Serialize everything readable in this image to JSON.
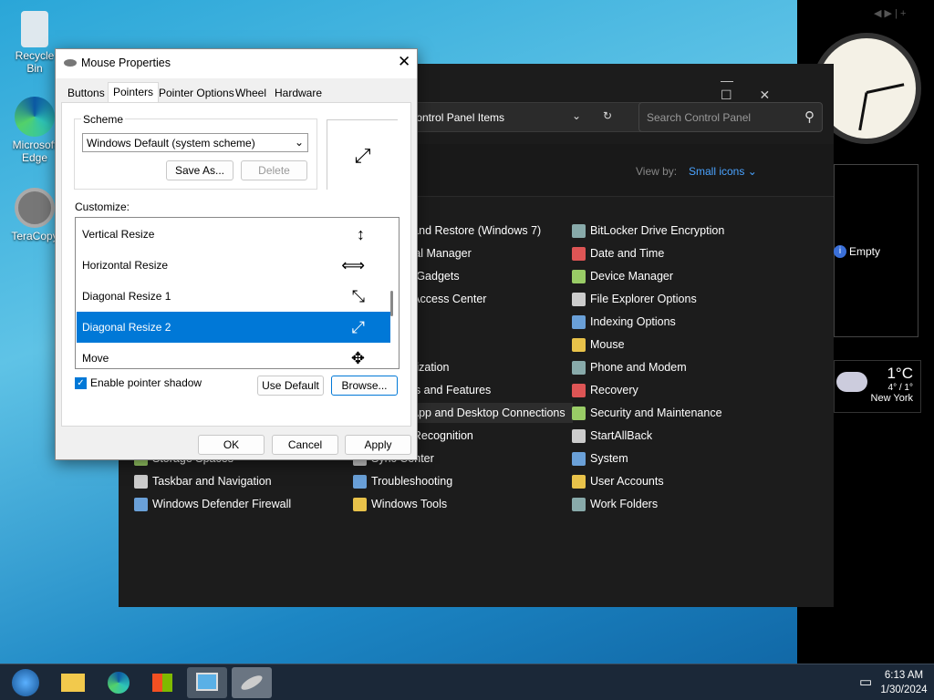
{
  "desktop": {
    "icons": [
      {
        "label": "Recycle Bin"
      },
      {
        "label": "Microsoft Edge"
      },
      {
        "label": "TeraCopy"
      }
    ]
  },
  "gadgets": {
    "slideshow_status": "Empty",
    "weather": {
      "temp": "1°C",
      "range": "4° / 1°",
      "city": "New York"
    },
    "clock": {
      "time": "6:13"
    }
  },
  "control_panel": {
    "address": "All Control Panel Items",
    "search_placeholder": "Search Control Panel",
    "view_by_label": "View by:",
    "view_by_value": "Small icons",
    "col1": [
      "",
      "",
      "",
      "",
      "",
      "",
      "",
      "",
      "",
      "",
      "Storage Spaces",
      "Taskbar and Navigation",
      "Windows Defender Firewall"
    ],
    "col2": [
      "Backup and Restore (Windows 7)",
      "Credential Manager",
      "Desktop Gadgets",
      "Ease of Access Center",
      "",
      "",
      "Personalization",
      "Programs and Features",
      "RemoteApp and Desktop Connections",
      "Speech Recognition",
      "Sync Center",
      "Troubleshooting",
      "Windows Tools"
    ],
    "col3": [
      "BitLocker Drive Encryption",
      "Date and Time",
      "Device Manager",
      "File Explorer Options",
      "Indexing Options",
      "Mouse",
      "Phone and Modem",
      "Recovery",
      "Security and Maintenance",
      "StartAllBack",
      "System",
      "User Accounts",
      "Work Folders"
    ],
    "hovered": "RemoteApp and Desktop Connections"
  },
  "dialog": {
    "title": "Mouse Properties",
    "tabs": [
      "Buttons",
      "Pointers",
      "Pointer Options",
      "Wheel",
      "Hardware"
    ],
    "active_tab": "Pointers",
    "scheme_label": "Scheme",
    "scheme_value": "Windows Default (system scheme)",
    "save_as": "Save As...",
    "delete": "Delete",
    "customize_label": "Customize:",
    "pointers": [
      {
        "name": "Vertical Resize",
        "glyph": "↕"
      },
      {
        "name": "Horizontal Resize",
        "glyph": "⟺"
      },
      {
        "name": "Diagonal Resize 1",
        "glyph": "⤡"
      },
      {
        "name": "Diagonal Resize 2",
        "glyph": "⤢"
      },
      {
        "name": "Move",
        "glyph": "✥"
      }
    ],
    "selected_pointer": "Diagonal Resize 2",
    "preview_glyph": "⤢",
    "shadow_label": "Enable pointer shadow",
    "shadow_checked": true,
    "use_default": "Use Default",
    "browse": "Browse...",
    "ok": "OK",
    "cancel": "Cancel",
    "apply": "Apply"
  },
  "taskbar": {
    "time": "6:13 AM",
    "date": "1/30/2024"
  },
  "colors": {
    "accent": "#0078d7",
    "link": "#4aa3ff"
  }
}
